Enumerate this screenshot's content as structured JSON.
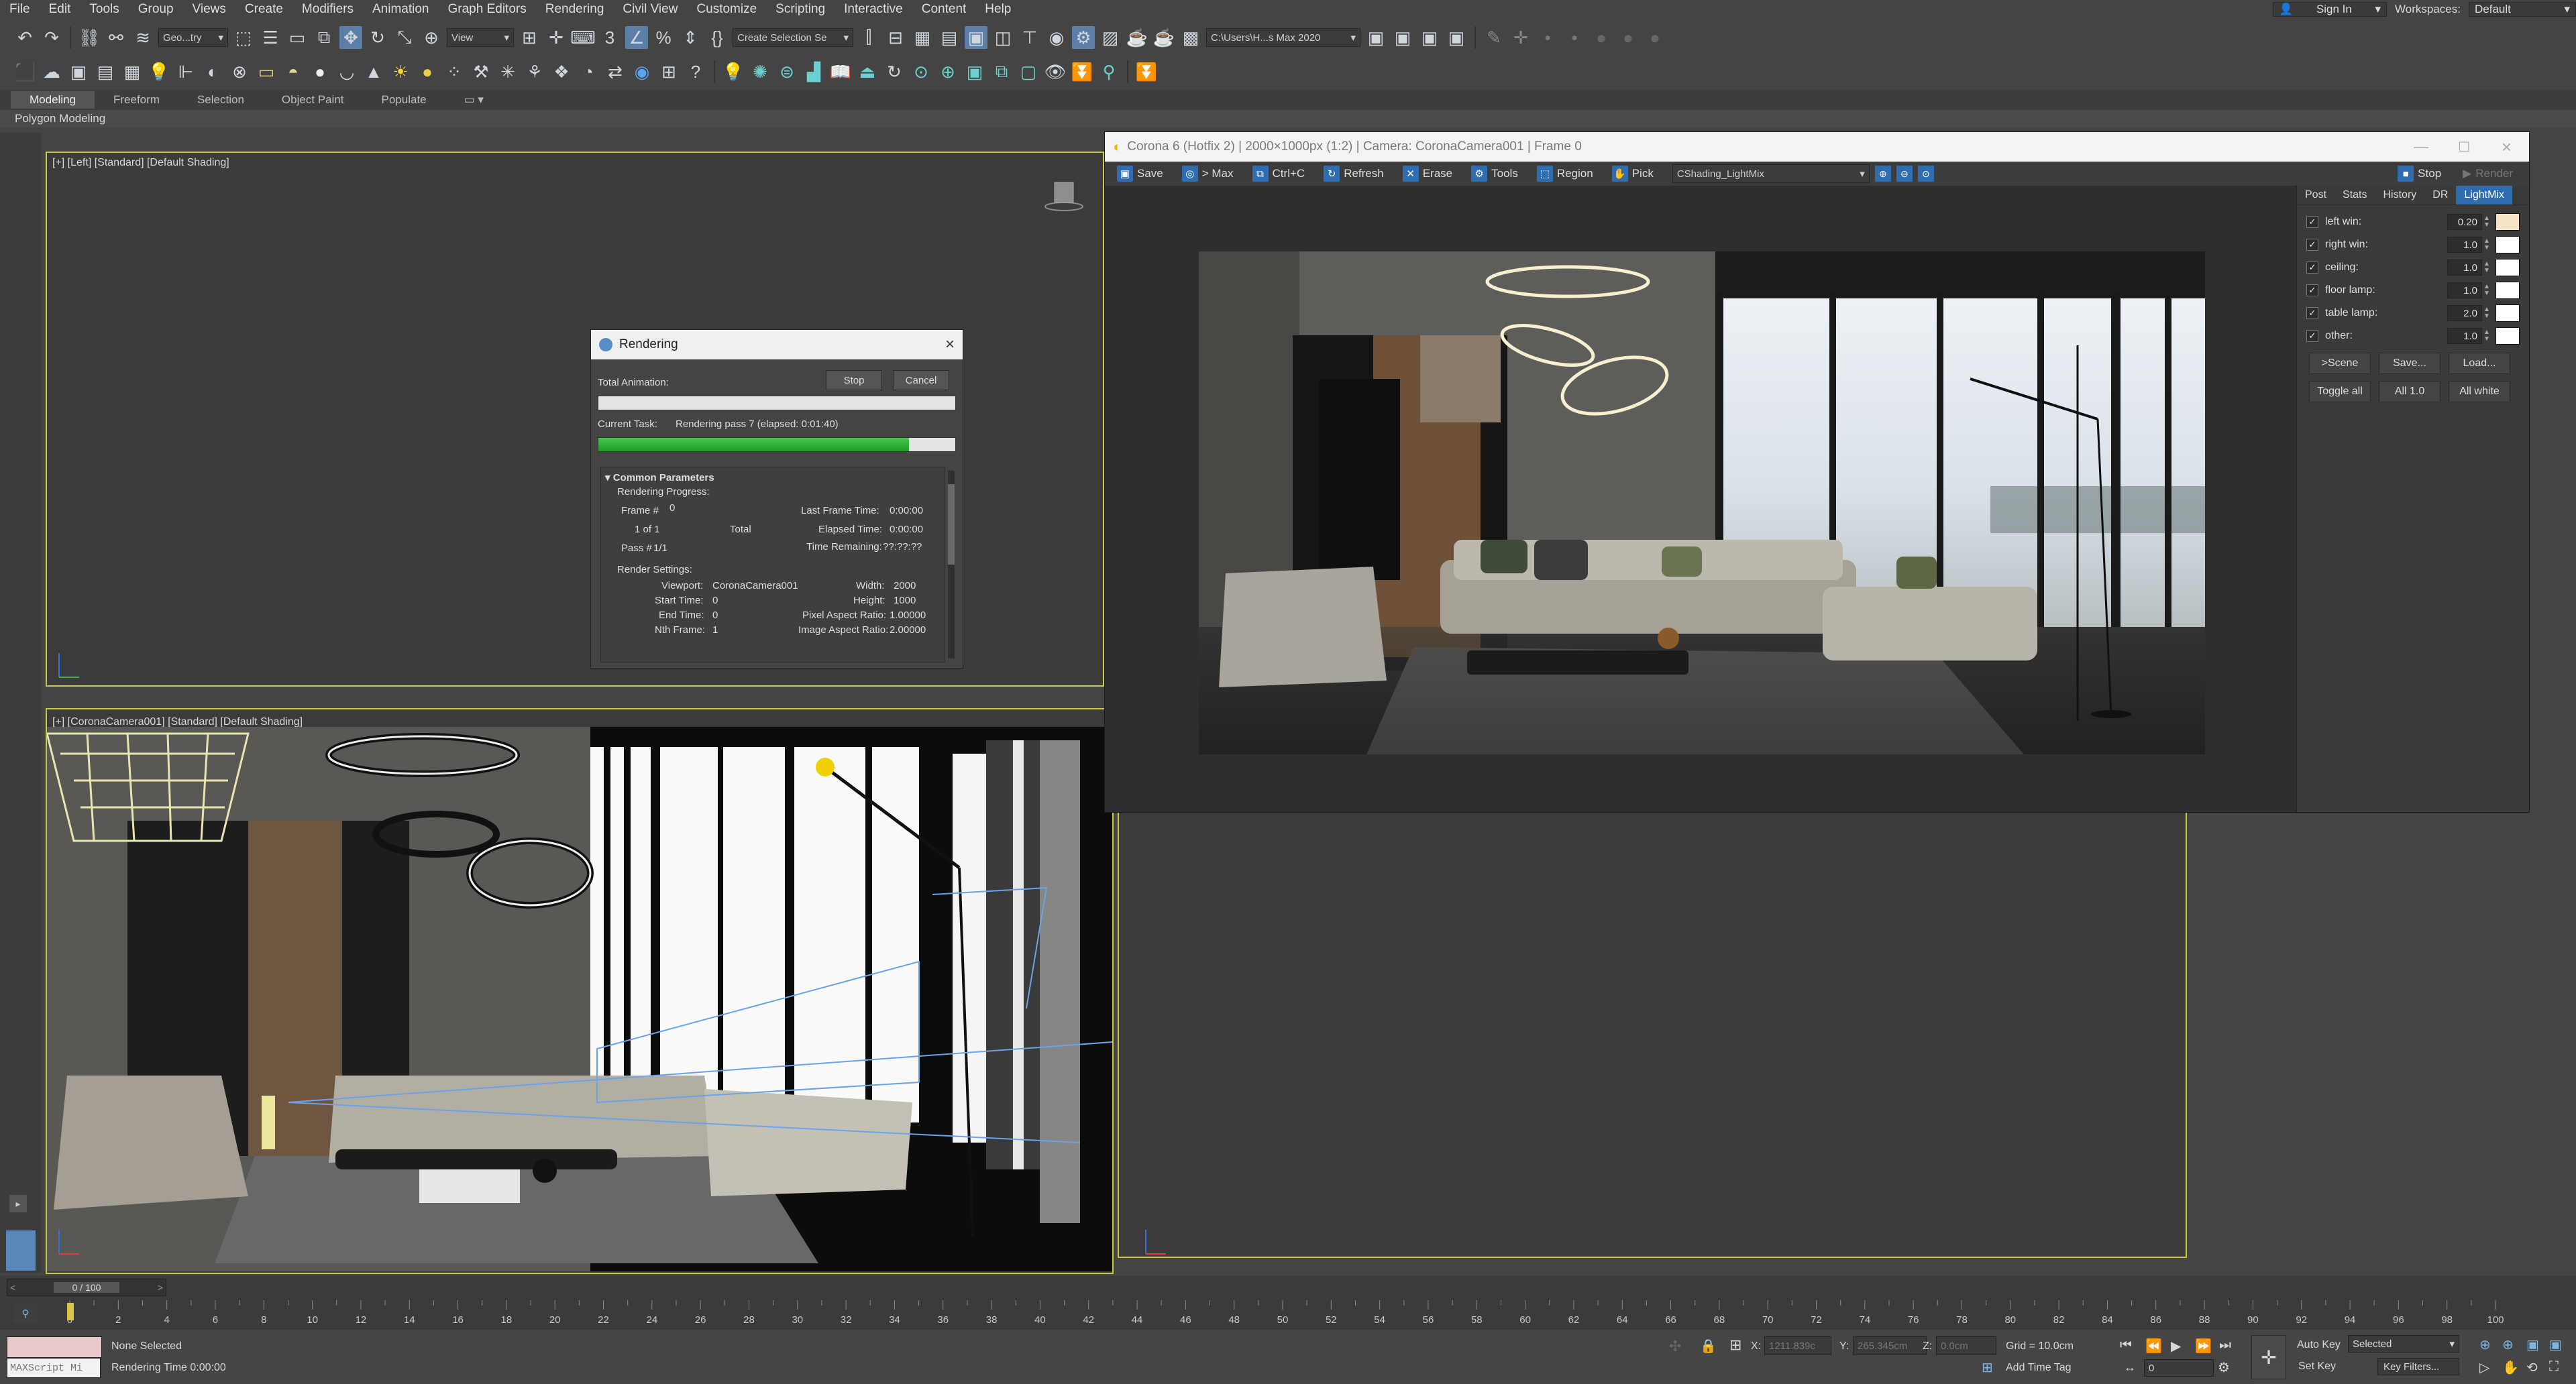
{
  "menu": {
    "items": [
      "File",
      "Edit",
      "Tools",
      "Group",
      "Views",
      "Create",
      "Modifiers",
      "Animation",
      "Graph Editors",
      "Rendering",
      "Civil View",
      "Customize",
      "Scripting",
      "Interactive",
      "Content",
      "Help"
    ],
    "sign_in": "Sign In",
    "workspaces_label": "Workspaces:",
    "workspace": "Default"
  },
  "toolbar": {
    "selection_filter": "Geo...try",
    "ref_coord": "View",
    "named_sel": "Create Selection Se",
    "project_path": "C:\\Users\\H...s Max 2020"
  },
  "ribbon": {
    "tabs": [
      "Modeling",
      "Freeform",
      "Selection",
      "Object Paint",
      "Populate"
    ],
    "active": "Modeling",
    "panel": "Polygon Modeling"
  },
  "viewports": {
    "top_left": "[+] [Left] [Standard] [Default Shading]",
    "bottom_left": "[+] [CoronaCamera001] [Standard] [Default Shading]"
  },
  "vfb": {
    "title": "Corona 6 (Hotfix 2) | 2000×1000px (1:2) | Camera: CoronaCamera001 | Frame 0",
    "buttons": [
      "Save",
      "> Max",
      "Ctrl+C",
      "Refresh",
      "Erase",
      "Tools",
      "Region",
      "Pick"
    ],
    "channel": "CShading_LightMix",
    "stop": "Stop",
    "render": "Render",
    "tabs": [
      "Post",
      "Stats",
      "History",
      "DR",
      "LightMix"
    ],
    "active_tab": "LightMix",
    "lights": [
      {
        "name": "left win:",
        "value": "0.20",
        "color": "#f6e4c6"
      },
      {
        "name": "right win:",
        "value": "1.0",
        "color": "#ffffff"
      },
      {
        "name": "ceiling:",
        "value": "1.0",
        "color": "#ffffff"
      },
      {
        "name": "floor lamp:",
        "value": "1.0",
        "color": "#ffffff"
      },
      {
        "name": "table lamp:",
        "value": "2.0",
        "color": "#ffffff"
      },
      {
        "name": "other:",
        "value": "1.0",
        "color": "#ffffff"
      }
    ],
    "row1": [
      ">Scene",
      "Save...",
      "Load..."
    ],
    "row2": [
      "Toggle all",
      "All 1.0",
      "All white"
    ]
  },
  "render_dialog": {
    "title": "Rendering",
    "stop": "Stop",
    "cancel": "Cancel",
    "total_animation": "Total Animation:",
    "current_task_label": "Current Task:",
    "current_task": "Rendering pass 7 (elapsed: 0:01:40)",
    "progress": 0.87,
    "section": "Common Parameters",
    "progress_heading": "Rendering Progress:",
    "frame_label": "Frame #",
    "frame": "0",
    "of_label": "1 of 1",
    "total_label": "Total",
    "pass_label": "Pass #",
    "pass": "1/1",
    "last_frame_label": "Last Frame Time:",
    "last_frame": "0:00:00",
    "elapsed_label": "Elapsed Time:",
    "elapsed": "0:00:00",
    "remaining_label": "Time Remaining:",
    "remaining": "??:??:??",
    "settings_heading": "Render Settings:",
    "viewport_label": "Viewport:",
    "viewport": "CoronaCamera001",
    "width_label": "Width:",
    "width": "2000",
    "start_label": "Start Time:",
    "start": "0",
    "height_label": "Height:",
    "height": "1000",
    "end_label": "End Time:",
    "end": "0",
    "pixel_aspect_label": "Pixel Aspect Ratio:",
    "pixel_aspect": "1.00000",
    "nth_label": "Nth Frame:",
    "nth": "1",
    "image_aspect_label": "Image Aspect Ratio:",
    "image_aspect": "2.00000"
  },
  "timeline": {
    "frame_counter": "0 / 100",
    "ticks": [
      "0",
      "2",
      "4",
      "6",
      "8",
      "10",
      "12",
      "14",
      "16",
      "18",
      "20",
      "22",
      "24",
      "26",
      "28",
      "30",
      "32",
      "34",
      "36",
      "38",
      "40",
      "42",
      "44",
      "46",
      "48",
      "50",
      "52",
      "54",
      "56",
      "58",
      "60",
      "62",
      "64",
      "66",
      "68",
      "70",
      "72",
      "74",
      "76",
      "78",
      "80",
      "82",
      "84",
      "86",
      "88",
      "90",
      "92",
      "94",
      "96",
      "98",
      "100"
    ]
  },
  "status": {
    "script_label": "MAXScript Mi",
    "selection": "None Selected",
    "render_time": "Rendering Time  0:00:00",
    "x_label": "X:",
    "x": "1211.839c",
    "y_label": "Y:",
    "y": "265.345cm",
    "z_label": "Z:",
    "z": "0.0cm",
    "grid": "Grid = 10.0cm",
    "add_time_tag": "Add Time Tag",
    "auto_key": "Auto Key",
    "selected": "Selected",
    "set_key": "Set Key",
    "key_filters": "Key Filters...",
    "frame": "0"
  }
}
